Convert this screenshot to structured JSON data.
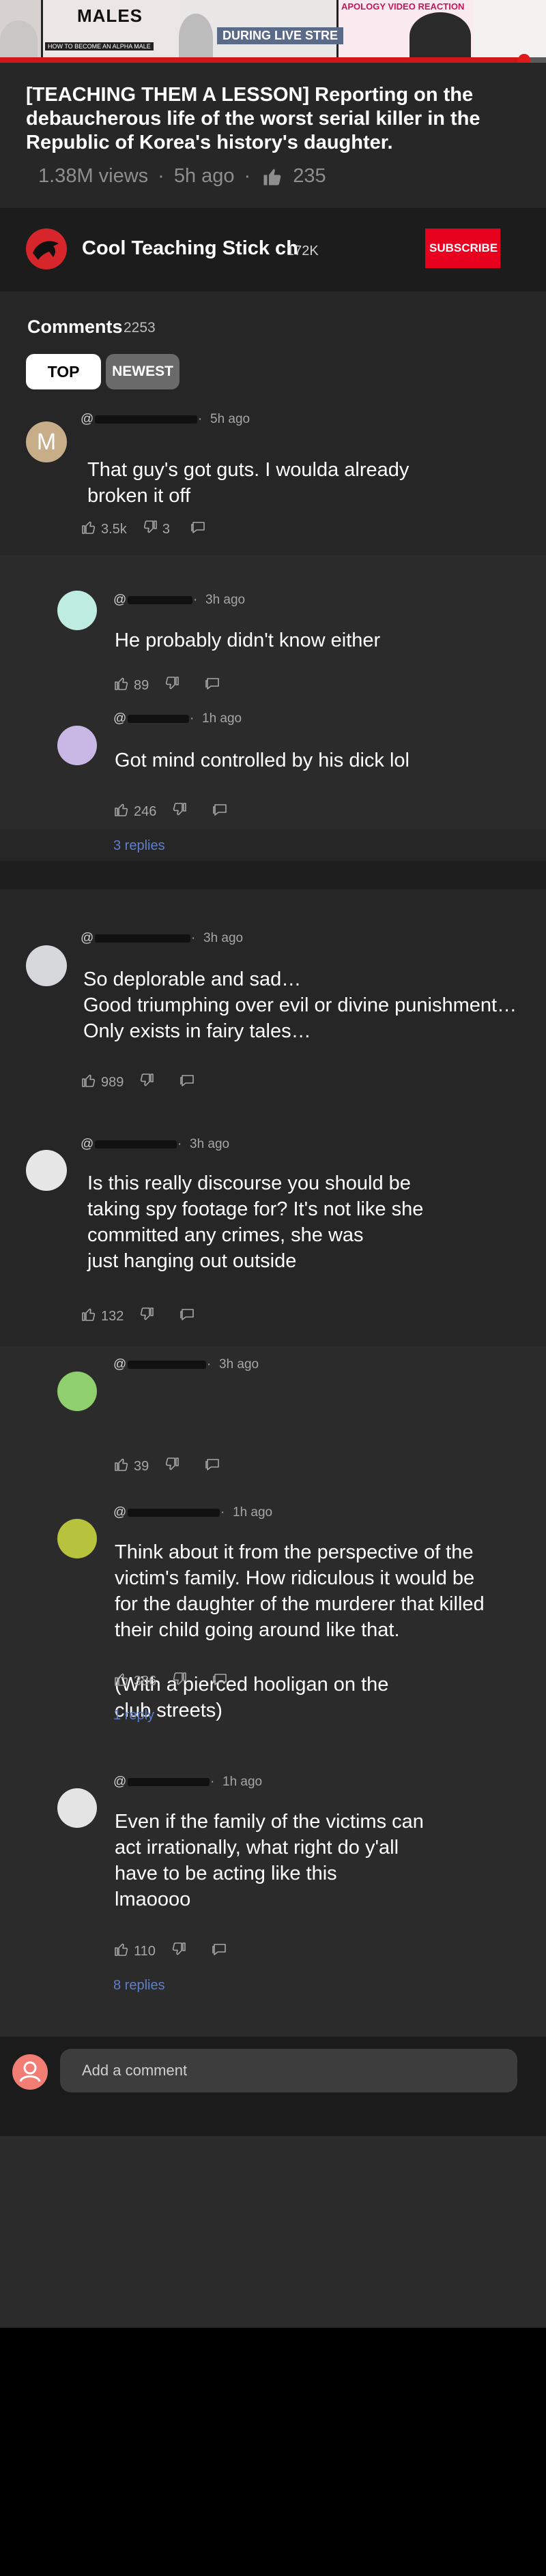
{
  "video": {
    "thumb_text_males": "MALES",
    "thumb_text_how": "HOW TO BECOME AN ALPHA MALE",
    "thumb_text_live": "DURING LIVE STRE",
    "thumb_text_apology": "APOLOGY VIDEO REACTION",
    "progress_fraction": 0.96
  },
  "info": {
    "title": "[TEACHING THEM A LESSON] Reporting on the debaucherous life of the worst serial killer in the Republic of Korea's history's daughter.",
    "views": "1.38M views",
    "age": "5h ago",
    "likes": "235"
  },
  "channel": {
    "name": "Cool Teaching Stick ch",
    "subscribers": "172K",
    "subscribe_label": "SUBSCRIBE",
    "avatar_color": "#d7262b"
  },
  "comments": {
    "heading": "Comments",
    "count": "2253",
    "tabs": [
      "TOP",
      "NEWEST"
    ],
    "items": [
      {
        "initial": "M",
        "time": "5h ago",
        "text": "That guy's got guts. I woulda already\nbroken it off",
        "likes": "3.5k",
        "dislikes": "3",
        "replies": ""
      },
      {
        "initial": "",
        "time": "3h ago",
        "text": "He probably didn't know either",
        "likes": "89",
        "dislikes": "",
        "replies": ""
      },
      {
        "initial": "",
        "time": "1h ago",
        "text": "Got mind controlled by his dick lol",
        "likes": "246",
        "dislikes": "",
        "replies": "3 replies"
      },
      {
        "initial": "",
        "time": "3h ago",
        "text": "So deplorable and sad…\nGood triumphing over evil or divine punishment…\nOnly exists in fairy tales…",
        "likes": "989",
        "dislikes": "",
        "replies": ""
      },
      {
        "initial": "",
        "time": "3h ago",
        "text": "Is this really discourse you should be\ntaking spy footage for? It's not like she\ncommitted any crimes, she was\njust hanging out outside",
        "likes": "132",
        "dislikes": "",
        "replies": ""
      },
      {
        "initial": "",
        "time": "3h ago",
        "text": "(With a pierced hooligan on the\nclub streets)",
        "likes": "39",
        "dislikes": "",
        "replies": ""
      },
      {
        "initial": "",
        "time": "1h ago",
        "text": "Think about it from the perspective of the\nvictim's family. How ridiculous it would be\nfor the daughter of the murderer that killed\ntheir child going around like that.",
        "likes": "386",
        "dislikes": "",
        "replies": "1 reply"
      },
      {
        "initial": "",
        "time": "1h ago",
        "text": "Even if the family of the victims can\nact irrationally, what right do y'all\nhave to be acting like this\nlmaoooo",
        "likes": "110",
        "dislikes": "",
        "replies": "8 replies"
      }
    ],
    "add_placeholder": "Add a comment",
    "avatar_colors": [
      "#c7ae89",
      "#bfece0",
      "#c9b8e6",
      "#d6d8dc",
      "#e6e6e6",
      "#8fcf6e",
      "#b7c33c",
      "#e4e4e4"
    ]
  }
}
